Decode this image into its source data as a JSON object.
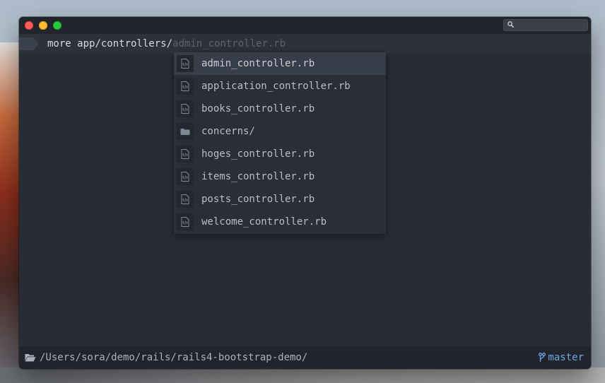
{
  "prompt": {
    "typed": "more app/controllers/",
    "suggestion": "admin_controller.rb"
  },
  "autocomplete": {
    "items": [
      {
        "label": "admin_controller.rb",
        "icon": "ruby-file-icon"
      },
      {
        "label": "application_controller.rb",
        "icon": "ruby-file-icon"
      },
      {
        "label": "books_controller.rb",
        "icon": "ruby-file-icon"
      },
      {
        "label": "concerns/",
        "icon": "folder-icon"
      },
      {
        "label": "hoges_controller.rb",
        "icon": "ruby-file-icon"
      },
      {
        "label": "items_controller.rb",
        "icon": "ruby-file-icon"
      },
      {
        "label": "posts_controller.rb",
        "icon": "ruby-file-icon"
      },
      {
        "label": "welcome_controller.rb",
        "icon": "ruby-file-icon"
      }
    ],
    "selected_index": 0
  },
  "status": {
    "path": "/Users/sora/demo/rails/rails4-bootstrap-demo/",
    "branch": "master",
    "branch_color": "#6aa5e6"
  },
  "colors": {
    "window_bg": "#282c34",
    "titlebar_bg": "#21252b",
    "accent": "#6aa5e6"
  }
}
